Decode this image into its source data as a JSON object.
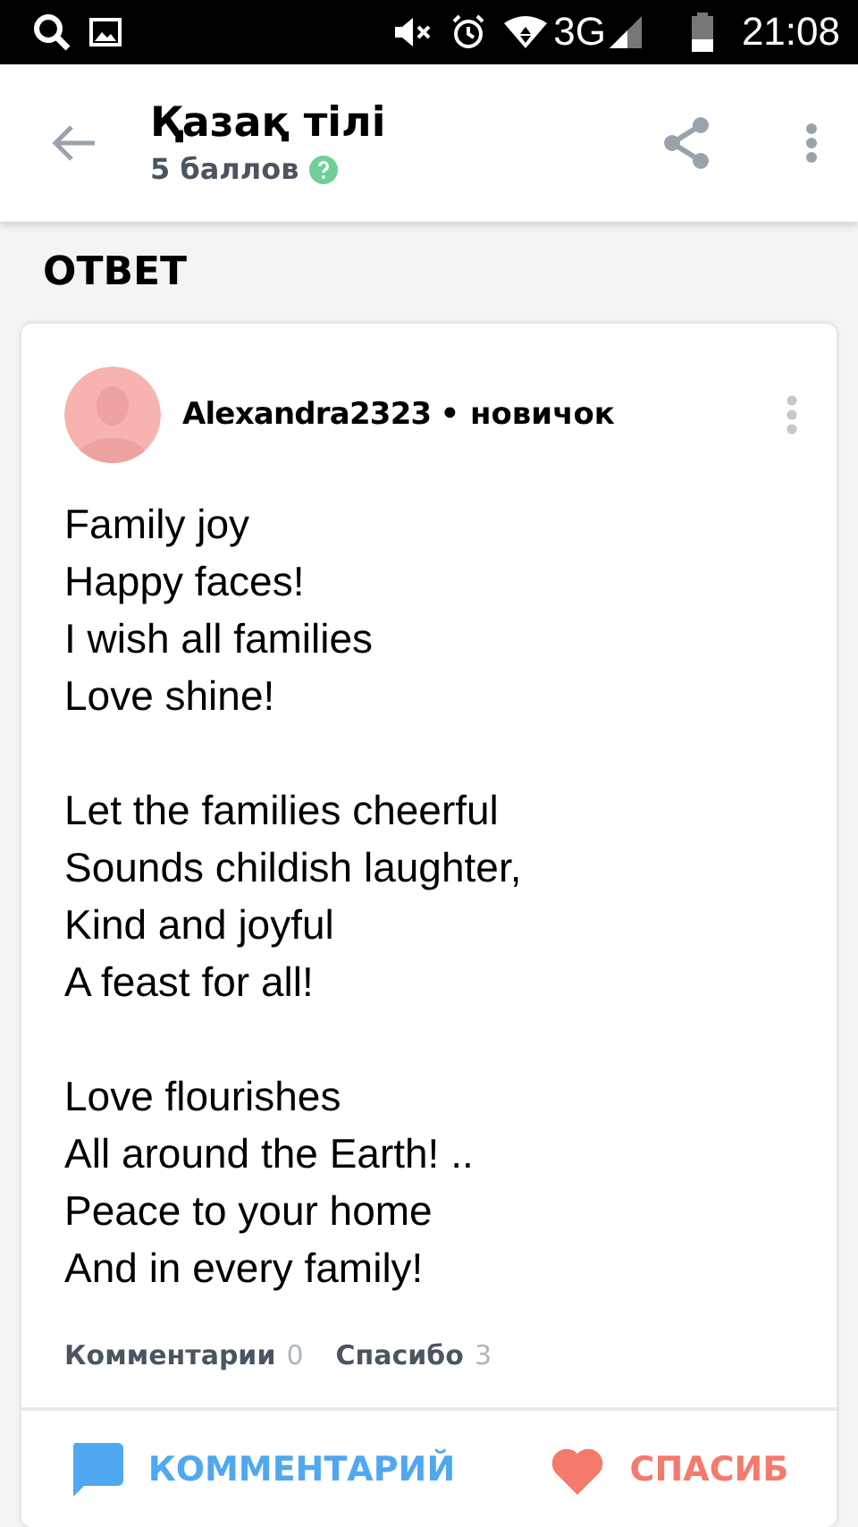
{
  "status_bar": {
    "network": "3G",
    "time": "21:08"
  },
  "app_bar": {
    "title": "Қазақ тілі",
    "points": "5 баллов"
  },
  "section_title": "ОТВЕТ",
  "answer": {
    "author": "Alexandra2323",
    "rank": "• новичок",
    "stanzas": [
      [
        "Family joy",
        "Happy faces!",
        "I wish all families",
        "Love shine!"
      ],
      [
        "Let the families cheerful",
        "Sounds childish laughter,",
        "Kind and joyful",
        "A feast for all!"
      ],
      [
        "Love flourishes",
        "All around the Earth! ..",
        "Peace to your home",
        "And in every family!"
      ]
    ],
    "stats": [
      {
        "label": "Комментарии",
        "count": "0"
      },
      {
        "label": "Спасибо",
        "count": "3"
      }
    ],
    "actions": [
      {
        "kind": "comment",
        "label": "КОММЕНТАРИЙ"
      },
      {
        "kind": "thanks",
        "label": "СПАСИБ"
      }
    ]
  }
}
